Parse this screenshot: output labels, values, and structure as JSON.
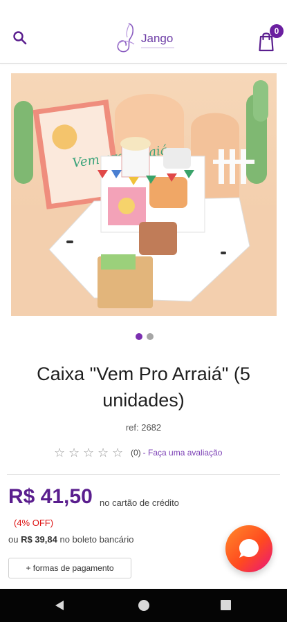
{
  "header": {
    "logo_text": "Jango",
    "cart_count": "0"
  },
  "product": {
    "title": "Caixa \"Vem Pro Arraiá\" (5 unidades)",
    "ref": "ref: 2682",
    "image_text": "Vem pro Arraiá",
    "gallery_pages": 2,
    "gallery_active": 1
  },
  "rating": {
    "stars_total": 5,
    "stars_filled": 0,
    "count": "(0)",
    "link": "Faça uma avaliação"
  },
  "pricing": {
    "price": "R$ 41,50",
    "price_note": "no cartão de crédito",
    "discount": "(4% OFF)",
    "boleto_prefix": "ou",
    "boleto_price": "R$ 39,84",
    "boleto_suffix": "no boleto bancário",
    "payment_button": "+ formas de pagamento"
  },
  "colors": {
    "brand": "#6b1fa0",
    "price": "#5a1e8e",
    "link": "#7b3fb5",
    "discount": "#dd1111",
    "chat_gradient_start": "#ff8a2a",
    "chat_gradient_end": "#e8157f"
  },
  "icons": [
    "search-icon",
    "cart-icon",
    "chat-icon",
    "nav-back-icon",
    "nav-home-icon",
    "nav-recents-icon"
  ]
}
